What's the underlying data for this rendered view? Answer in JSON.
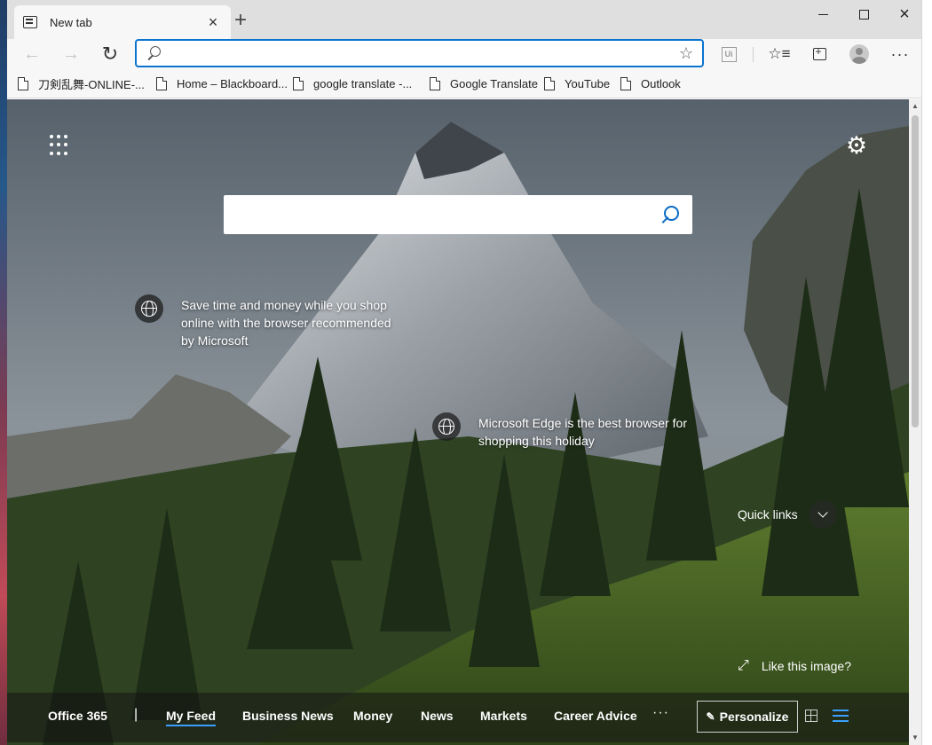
{
  "tab": {
    "title": "New tab"
  },
  "address_bar": {
    "value": "",
    "placeholder": ""
  },
  "favorites": [
    {
      "label": "刀剣乱舞-ONLINE-..."
    },
    {
      "label": "Home – Blackboard..."
    },
    {
      "label": "google translate -..."
    },
    {
      "label": "Google Translate"
    },
    {
      "label": "YouTube"
    },
    {
      "label": "Outlook"
    }
  ],
  "search": {
    "value": "",
    "placeholder": ""
  },
  "hotspots": [
    {
      "text": "Save time and money while you shop online with the browser recommended by Microsoft"
    },
    {
      "text": "Microsoft Edge is the best browser for shopping this holiday"
    }
  ],
  "quick_links": {
    "label": "Quick links"
  },
  "like_image": {
    "label": "Like this image?"
  },
  "feed_nav": {
    "office": "Office 365",
    "separator": "|",
    "items": [
      {
        "label": "My Feed",
        "active": true
      },
      {
        "label": "Business News",
        "active": false
      },
      {
        "label": "Money",
        "active": false
      },
      {
        "label": "News",
        "active": false
      },
      {
        "label": "Markets",
        "active": false
      },
      {
        "label": "Career Advice",
        "active": false
      }
    ],
    "more": "···",
    "personalize": "Personalize"
  },
  "colors": {
    "accent": "#0b74cf",
    "active_tab_underline": "#3aa0ff"
  }
}
